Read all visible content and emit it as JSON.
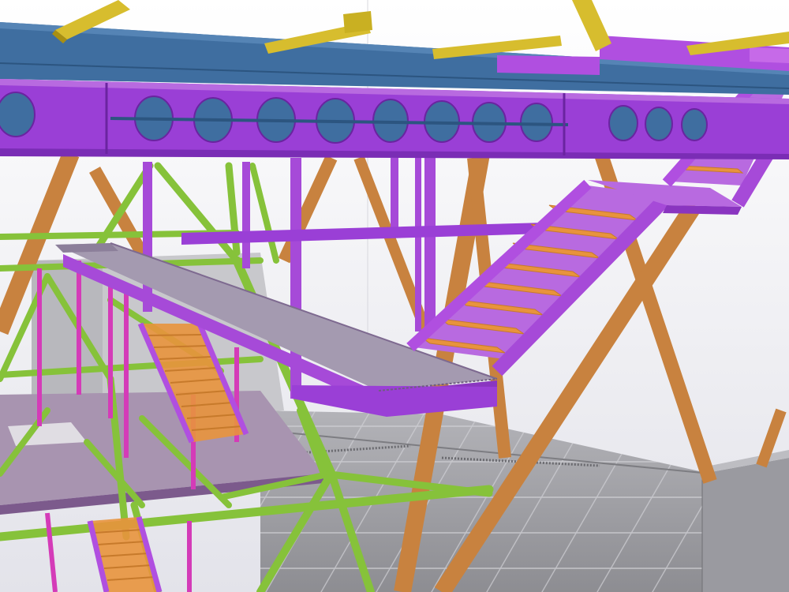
{
  "viewport": {
    "background": "#f2f2f4",
    "view_type": "3d-structural-model"
  },
  "colors": {
    "primary_beam_purple": "#9a3fd6",
    "secondary_purple": "#b04fe0",
    "magenta_columns": "#d43bb8",
    "green_bracing": "#86c23a",
    "orange_diagonal_columns": "#c8823f",
    "blue_roof_beam": "#3f6ea0",
    "yellow_roof_members": "#d7bd2e",
    "stair_treads": "#e8933d",
    "concrete_floor": "#9c9ca0",
    "walkway_deck": "#a49ab0"
  },
  "model": {
    "members": [
      "roof-beam",
      "castellated-girder",
      "staircase",
      "walkway",
      "diagonal-columns",
      "bracing",
      "floor-slabs"
    ]
  }
}
